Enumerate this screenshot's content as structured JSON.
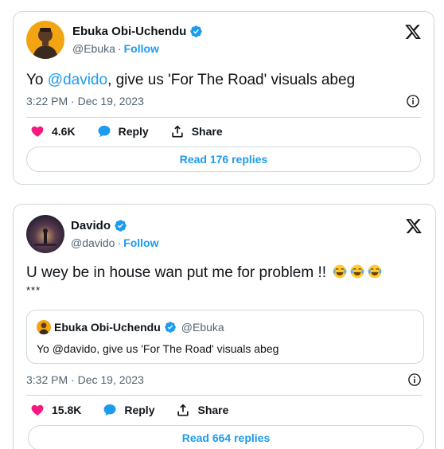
{
  "tweet1": {
    "display_name": "Ebuka Obi-Uchendu",
    "handle": "@Ebuka",
    "follow_label": "Follow",
    "text_prefix": "Yo ",
    "mention": "@davido",
    "text_suffix": ", give us 'For The Road' visuals abeg",
    "timestamp": "3:22 PM · Dec 19, 2023",
    "likes": "4.6K",
    "reply_label": "Reply",
    "share_label": "Share",
    "read_replies": "Read 176 replies"
  },
  "tweet2": {
    "display_name": "Davido",
    "handle": "@davido",
    "follow_label": "Follow",
    "text": "U wey be in house wan put me for problem !!",
    "stars": "***",
    "quote": {
      "display_name": "Ebuka Obi-Uchendu",
      "handle": "@Ebuka",
      "text": "Yo @davido, give us 'For The Road' visuals abeg"
    },
    "timestamp": "3:32 PM · Dec 19, 2023",
    "likes": "15.8K",
    "reply_label": "Reply",
    "share_label": "Share",
    "read_replies": "Read 664 replies"
  },
  "icons": {
    "verified": "verified-badge-icon",
    "x_logo": "x-logo-icon",
    "info": "info-icon",
    "heart": "heart-icon",
    "reply": "reply-bubble-icon",
    "share": "share-icon",
    "emoji": "tears-of-joy-emoji"
  },
  "colors": {
    "accent": "#1d9bf0",
    "like": "#f91880",
    "text": "#0f1419",
    "muted": "#536471",
    "border": "#cfd9de"
  }
}
